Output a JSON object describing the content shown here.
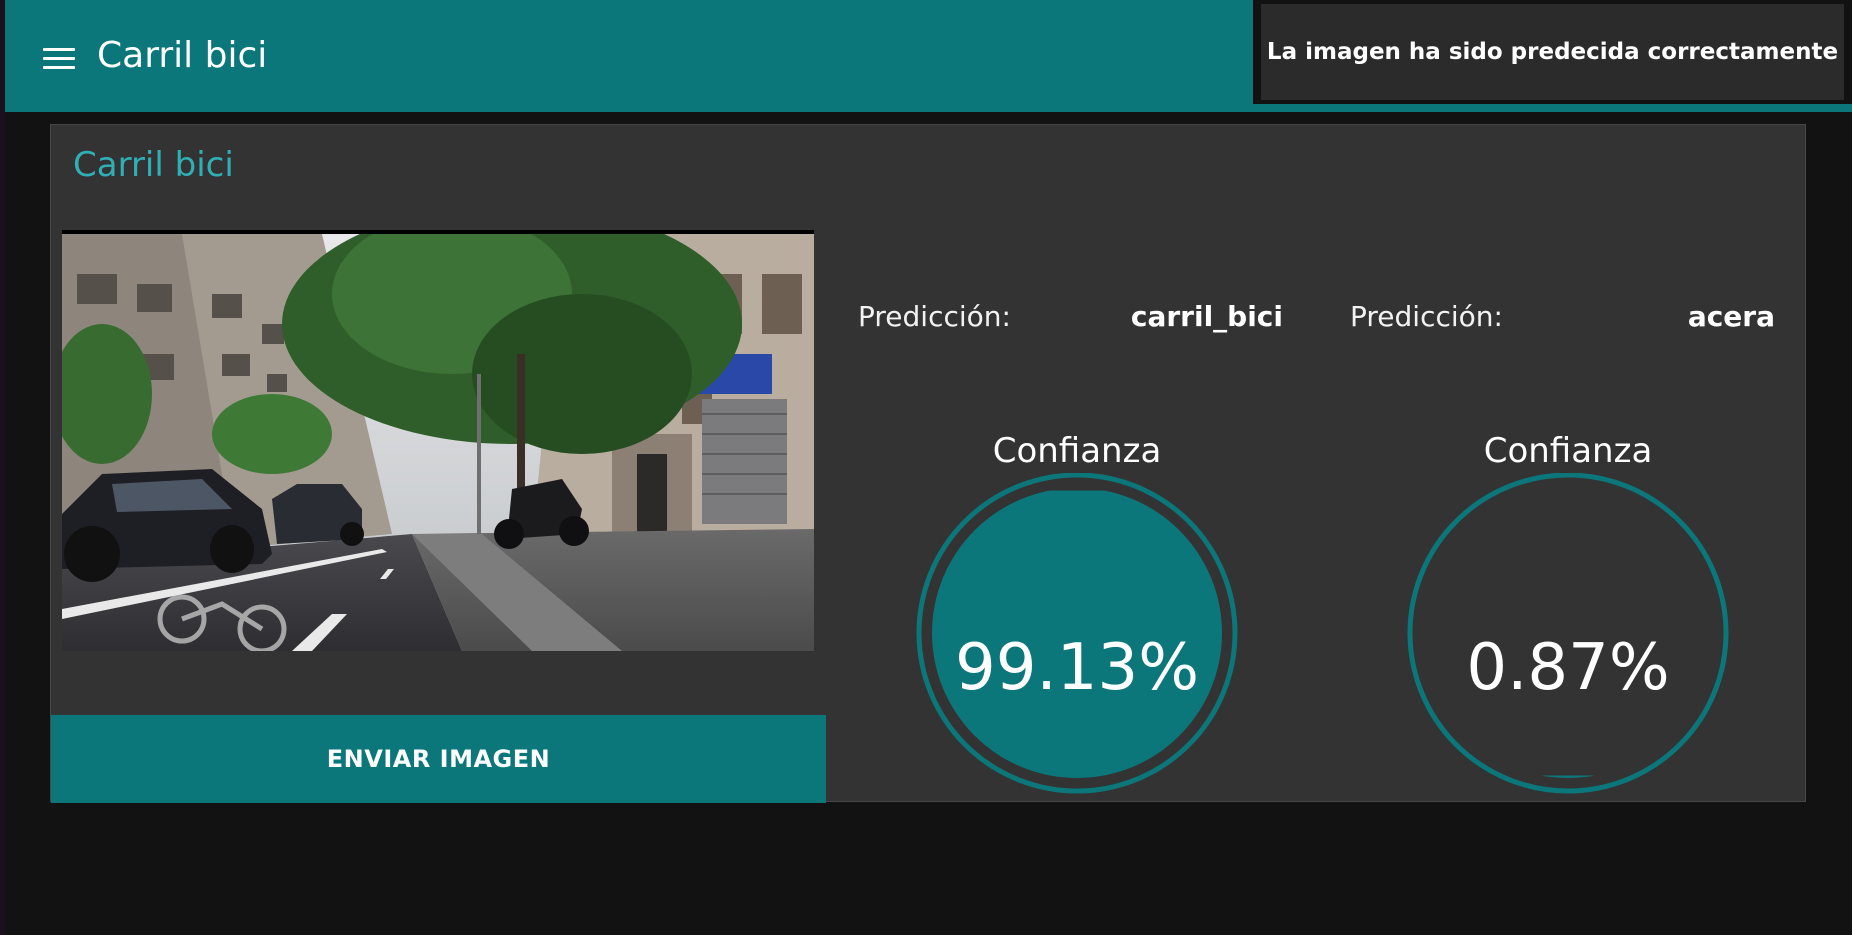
{
  "app": {
    "title": "Carril bici"
  },
  "snackbar": {
    "message": "La imagen ha sido predecida correctamente"
  },
  "card": {
    "title": "Carril bici",
    "send_button_label": "ENVIAR IMAGEN"
  },
  "predictions": [
    {
      "label": "Predicción:",
      "value": "carril_bici",
      "confidence_title": "Confianza",
      "confidence_text": "99.13%",
      "confidence_fraction": 0.9913
    },
    {
      "label": "Predicción:",
      "value": "acera",
      "confidence_title": "Confianza",
      "confidence_text": "0.87%",
      "confidence_fraction": 0.0087
    }
  ],
  "colors": {
    "accent": "#0b777b",
    "title_accent": "#2fb0b6",
    "card_background": "#333333",
    "page_background": "#121212"
  },
  "icons": {
    "menu": "hamburger-menu-icon"
  }
}
